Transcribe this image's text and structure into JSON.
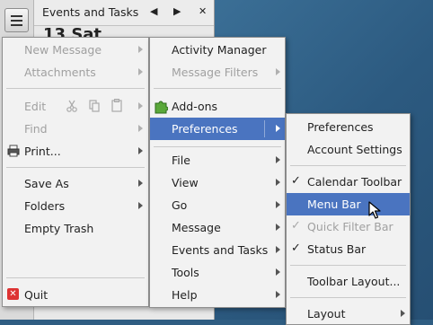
{
  "events_panel": {
    "title": "Events and Tasks",
    "prev": "◀",
    "next": "▶",
    "close": "✕",
    "date_text": "13 Sat"
  },
  "menu1": {
    "new_message": "New Message",
    "attachments": "Attachments",
    "edit": "Edit",
    "find": "Find",
    "print": "Print...",
    "save_as": "Save As",
    "folders": "Folders",
    "empty_trash": "Empty Trash",
    "quit": "Quit"
  },
  "menu2": {
    "activity_manager": "Activity Manager",
    "message_filters": "Message Filters",
    "add_ons": "Add-ons",
    "preferences": "Preferences",
    "file": "File",
    "view": "View",
    "go": "Go",
    "message": "Message",
    "events_and_tasks": "Events and Tasks",
    "tools": "Tools",
    "help": "Help"
  },
  "menu3": {
    "preferences": "Preferences",
    "account_settings": "Account Settings",
    "calendar_toolbar": "Calendar Toolbar",
    "menu_bar": "Menu Bar",
    "quick_filter_bar": "Quick Filter Bar",
    "status_bar": "Status Bar",
    "toolbar_layout": "Toolbar Layout...",
    "layout": "Layout"
  }
}
